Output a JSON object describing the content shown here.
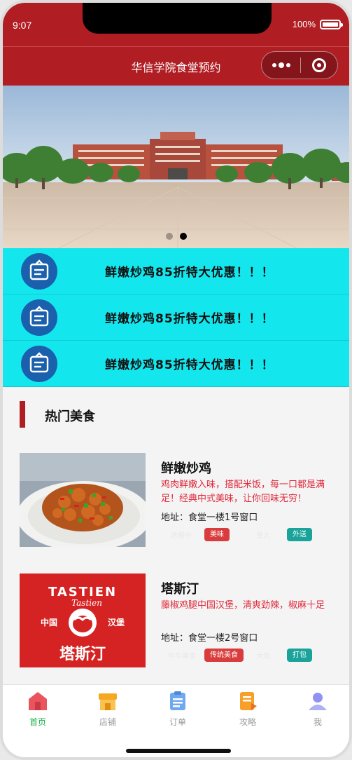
{
  "status_bar": {
    "time": "9:07",
    "battery": "100%"
  },
  "nav": {
    "title": "华信学院食堂预约",
    "more_icon": "more-dots-icon",
    "close_icon": "target-circle-icon"
  },
  "banner": {
    "slides": 2,
    "active_slide": 2
  },
  "notices": [
    {
      "icon": "clipboard-icon",
      "text": "鲜嫩炒鸡85折特大优惠！！！"
    },
    {
      "icon": "clipboard-icon",
      "text": "鲜嫩炒鸡85折特大优惠！！！"
    },
    {
      "icon": "clipboard-icon",
      "text": "鲜嫩炒鸡85折特大优惠！！！"
    }
  ],
  "hot_section": {
    "title": "热门美食"
  },
  "foods": [
    {
      "name": "鲜嫩炒鸡",
      "desc": "鸡肉鲜嫩入味，搭配米饭，每一口都是满足！经典中式美味，让你回味无穷！",
      "addr": "地址：食堂一楼1号窗口",
      "ghost_tags": [
        "送餐中",
        "量大"
      ],
      "tags": [
        "美味",
        "外送"
      ]
    },
    {
      "name": "塔斯汀",
      "desc": "藤椒鸡腿中国汉堡，清爽劲辣，椒麻十足",
      "addr": "地址：食堂一楼2号窗口",
      "ghost_tags": [
        "中华美食",
        "大饱"
      ],
      "tags": [
        "传统美食",
        "打包"
      ],
      "logo": {
        "en": "TASTIEN",
        "script": "Tastien",
        "left": "中国",
        "right": "汉堡",
        "cn": "塔斯汀"
      }
    }
  ],
  "tabbar": [
    {
      "label": "首页",
      "icon": "home-icon",
      "active": true
    },
    {
      "label": "店铺",
      "icon": "shop-icon",
      "active": false
    },
    {
      "label": "订单",
      "icon": "order-icon",
      "active": false
    },
    {
      "label": "攻略",
      "icon": "guide-icon",
      "active": false
    },
    {
      "label": "我",
      "icon": "profile-icon",
      "active": false
    }
  ],
  "colors": {
    "brand": "#b01e24",
    "notice_bg": "#14e6ee",
    "active_tab": "#1db14b",
    "desc_red": "#e0283a"
  }
}
